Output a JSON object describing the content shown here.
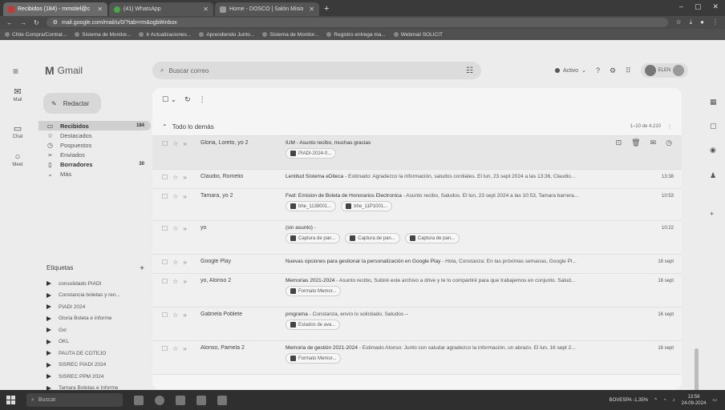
{
  "browser": {
    "tabs": [
      {
        "title": "Recibidos (184) - mmstiel@c",
        "active": true
      },
      {
        "title": "(41) WhatsApp",
        "active": false
      },
      {
        "title": "Home - DOSCO | Salón Misio",
        "active": false
      }
    ],
    "url": "mail.google.com/mail/u/0/?tab=rm&ogbl#inbox",
    "bookmarks": [
      "Chile Compra/Contrat...",
      "Sistema de Monitor...",
      "Ir Actualizaciones...",
      "Aprendiendo Junto...",
      "Sistema de Monitor...",
      "Registro entrega ma...",
      "Webmail SOLICIT"
    ]
  },
  "gmail": {
    "app_name": "Gmail",
    "search_placeholder": "Buscar correo",
    "status": "Activo",
    "account_badge": "ELEN",
    "rail": [
      {
        "icon": "mail-icon",
        "label": "Mail"
      },
      {
        "icon": "chat-icon",
        "label": "Chat"
      },
      {
        "icon": "meet-icon",
        "label": "Meet"
      }
    ],
    "compose_label": "Redactar",
    "nav": [
      {
        "label": "Recibidos",
        "count": "184",
        "icon": "inbox-icon",
        "active": true
      },
      {
        "label": "Destacados",
        "count": "",
        "icon": "star-icon",
        "active": false
      },
      {
        "label": "Pospuestos",
        "count": "",
        "icon": "clock-icon",
        "active": false
      },
      {
        "label": "Enviados",
        "count": "",
        "icon": "send-icon",
        "active": false
      },
      {
        "label": "Borradores",
        "count": "30",
        "icon": "draft-icon",
        "active": false
      },
      {
        "label": "Más",
        "count": "",
        "icon": "chevron-down-icon",
        "active": false
      }
    ],
    "labels_title": "Etiquetas",
    "labels": [
      "consolidado PIADI",
      "Constancia boletas y ren...",
      "PIADI 2024",
      "Gloria Boleta e informe",
      "Gxl",
      "OKL",
      "PAUTA DE COTEJO",
      "SISREC PIADI 2024",
      "SISREC PPM 2024",
      "Tamara Boletas e Informe"
    ],
    "section_title": "Todo lo demás",
    "pager": "1–10 de 4.210",
    "emails": [
      {
        "sender": "Gloria, Loreto, yo 2",
        "subject": "IUM - Asunto recibo, muchas gracias",
        "snippet": "",
        "time": "",
        "chips": [
          "PIADI-2024-0..."
        ],
        "hover": true
      },
      {
        "sender": "Claudio, Romelio",
        "subject": "Lentitud Sistema eDiteca",
        "snippet": " - Estimado: Agradezco la información, saludos cordiales. El lun, 23 sept 2024 a las 13:36, Claudio...",
        "time": "13:38",
        "chips": [],
        "hover": false
      },
      {
        "sender": "Tamara, yo 2",
        "subject": "Fwd: Emision de Boleta de Honorarios Electronica",
        "snippet": " - Asunto recibo, Saludos. El lun, 23 sept 2024 a las 10:53, Tamara barrera...",
        "time": "10:53",
        "chips": [
          "bhe_1139001...",
          "bhe_11P1001..."
        ],
        "hover": false
      },
      {
        "sender": "yo",
        "subject": "(sin asunto)",
        "snippet": " - ",
        "time": "10:22",
        "chips": [
          "Captura de pan...",
          "Captura de pan...",
          "Captura de pan..."
        ],
        "hover": false
      },
      {
        "sender": "Google Play",
        "subject": "Nuevas opciones para gestionar la personalización en Google Play",
        "snippet": " - Hola, Constanza: En las próximas semanas, Google Pl...",
        "time": "18 sept",
        "chips": [],
        "hover": false
      },
      {
        "sender": "yo, Alonso 2",
        "subject": "Memorias 2021-2024",
        "snippet": " - Asunto recibo, Subiré este archivo a drive y te lo compartiré para que trabajemos en conjunto. Salud...",
        "time": "16 sept",
        "chips": [
          "Formato Memor..."
        ],
        "hover": false
      },
      {
        "sender": "Gabriela Poblete",
        "subject": "programa",
        "snippet": " - Constanza, envío lo solicitado. Saludos --",
        "time": "16 sept",
        "chips": [
          "Estados de ava..."
        ],
        "hover": false
      },
      {
        "sender": "Alonso, Pamela 2",
        "subject": "Memoria de gestión 2021-2024",
        "snippet": " - Estimado Alonso: Junto con saludar agradezco la información, un abrazo. El lun, 16 sept 2...",
        "time": "16 sept",
        "chips": [
          "Formato Memor..."
        ],
        "hover": false
      }
    ]
  },
  "taskbar": {
    "search_placeholder": "Buscar",
    "weather": "BOVESPA -1,35%",
    "time": "13:56",
    "date": "24-09-2024"
  }
}
